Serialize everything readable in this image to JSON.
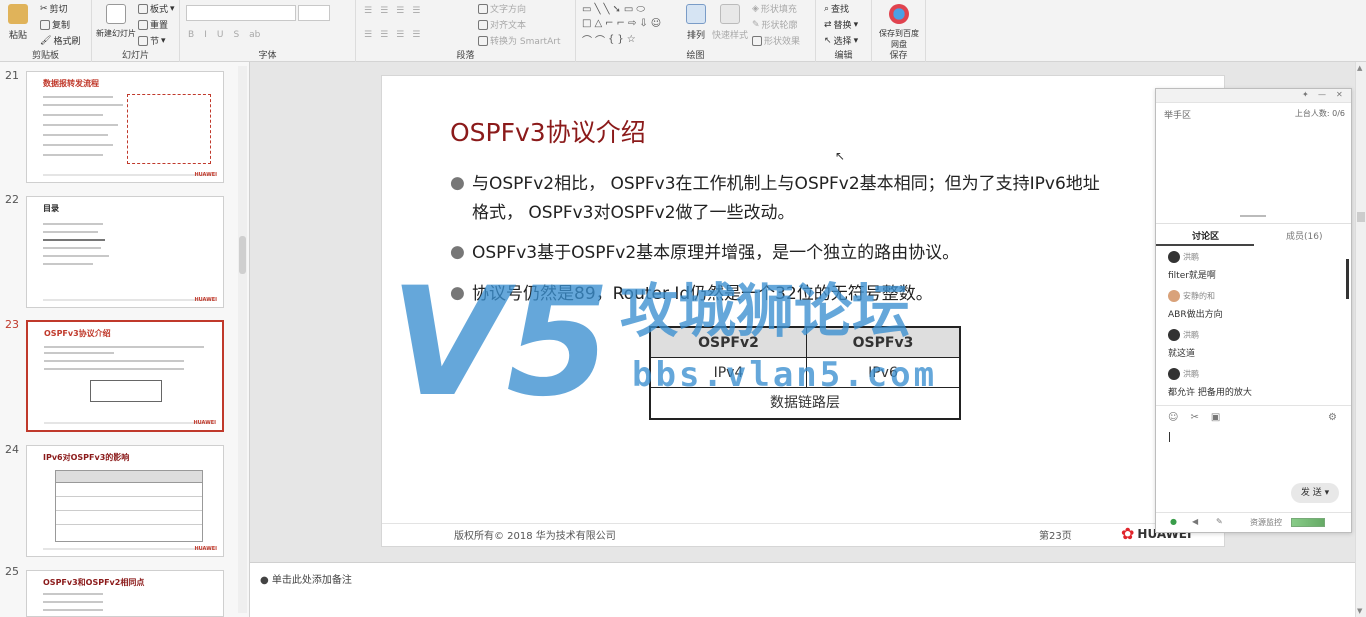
{
  "ribbon": {
    "groups": [
      {
        "label": "剪贴板",
        "items": [
          "粘贴",
          "剪切",
          "复制",
          "格式刷"
        ]
      },
      {
        "label": "幻灯片",
        "items": [
          "新建幻灯片",
          "板式",
          "重置",
          "节"
        ]
      },
      {
        "label": "字体",
        "items": [
          "B",
          "I",
          "U",
          "S",
          "ab"
        ]
      },
      {
        "label": "段落",
        "items": [
          "文字方向",
          "对齐文本",
          "转换为 SmartArt"
        ]
      },
      {
        "label": "绘图",
        "items": [
          "排列",
          "快速样式",
          "形状填充",
          "形状轮廓",
          "形状效果"
        ]
      },
      {
        "label": "编辑",
        "items": [
          "查找",
          "替换",
          "选择"
        ]
      },
      {
        "label": "保存",
        "items": [
          "保存到百度网盘"
        ]
      }
    ]
  },
  "thumbnails": [
    {
      "num": "21",
      "title": "数据报转发流程"
    },
    {
      "num": "22",
      "title": "目录"
    },
    {
      "num": "23",
      "title": "OSPFv3协议介绍",
      "selected": true
    },
    {
      "num": "24",
      "title": "IPv6对OSPFv3的影响"
    },
    {
      "num": "25",
      "title": "OSPFv3和OSPFv2相同点"
    }
  ],
  "slide": {
    "title": "OSPFv3协议介绍",
    "bullets": [
      "与OSPFv2相比， OSPFv3在工作机制上与OSPFv2基本相同；但为了支持IPv6地址格式， OSPFv3对OSPFv2做了一些改动。",
      "OSPFv3基于OSPFv2基本原理并增强，是一个独立的路由协议。",
      "协议号仍然是89，Router Id仍然是一个32位的无符号整数。"
    ],
    "table": {
      "headers": [
        "OSPFv2",
        "OSPFv3"
      ],
      "row": [
        "IPv4",
        "IPv6"
      ],
      "footer": "数据链路层"
    },
    "watermark": {
      "text": "攻城狮论坛",
      "url": "bbs.vlan5.com",
      "mark": "V5"
    },
    "copyright": "版权所有© 2018 华为技术有限公司",
    "page": "第23页",
    "logo": "HUAWEI"
  },
  "notes": {
    "placeholder": "单击此处添加备注"
  },
  "chat": {
    "raise_hand": "举手区",
    "online": "上台人数: 0/6",
    "tabs": [
      "讨论区",
      "成员(16)"
    ],
    "messages": [
      {
        "name": "洪鹏",
        "text": "filter就是啊"
      },
      {
        "name": "安静的和",
        "text": "ABR做出方向"
      },
      {
        "name": "洪鹏",
        "text": "就这道"
      },
      {
        "name": "洪鹏",
        "text": "都允许 把备用的放大"
      }
    ],
    "send": "发 送",
    "resource_monitor": "资源监控"
  },
  "colors": {
    "accent": "#8b1a1a",
    "watermark": "#3a8fd0",
    "selected": "#c0392b"
  }
}
